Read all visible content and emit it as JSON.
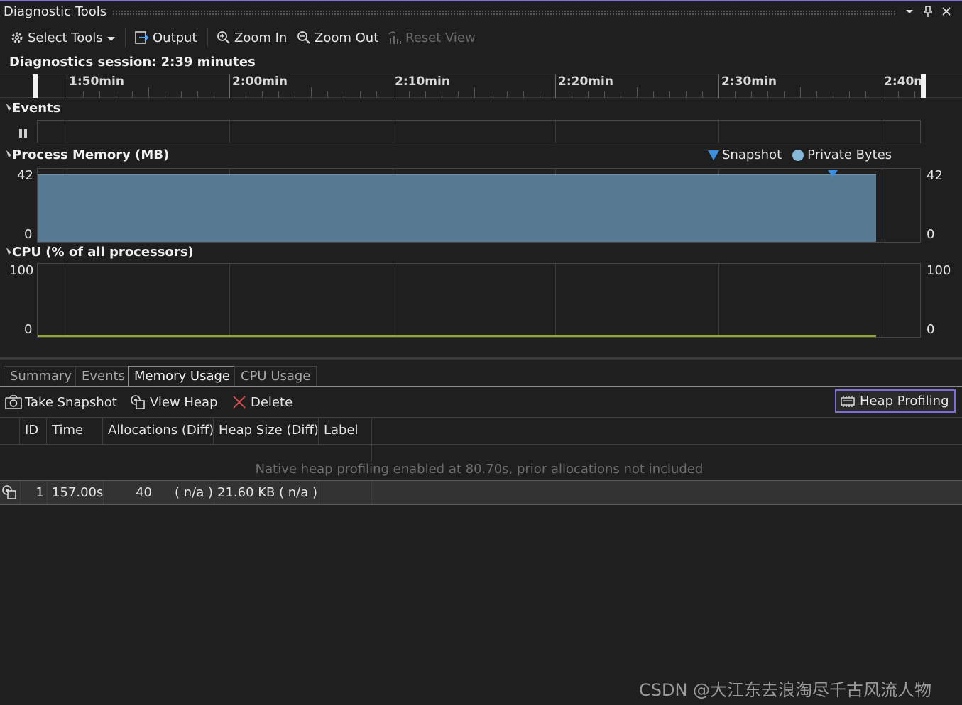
{
  "window": {
    "title": "Diagnostic Tools",
    "title_buttons": [
      "dropdown",
      "pin",
      "close"
    ]
  },
  "toolbar": {
    "select_tools": "Select Tools",
    "output": "Output",
    "zoom_in": "Zoom In",
    "zoom_out": "Zoom Out",
    "reset_view": "Reset View"
  },
  "session": {
    "label": "Diagnostics session: 2:39 minutes"
  },
  "ruler": {
    "labels": [
      "1:50min",
      "2:00min",
      "2:10min",
      "2:20min",
      "2:30min",
      "2:40m"
    ]
  },
  "events": {
    "title": "Events"
  },
  "memory": {
    "title": "Process Memory (MB)",
    "legend_snapshot": "Snapshot",
    "legend_private": "Private Bytes",
    "y_max": "42",
    "y_min": "0",
    "y_max_right": "42",
    "y_min_right": "0",
    "fill_color": "#567a91",
    "snapshot_color": "#3b8fe0",
    "private_color": "#86b8d8"
  },
  "cpu": {
    "title": "CPU (% of all processors)",
    "y_max": "100",
    "y_min": "0",
    "y_max_right": "100",
    "y_min_right": "0",
    "line_color": "#8fa832"
  },
  "tabs": [
    "Summary",
    "Events",
    "Memory Usage",
    "CPU Usage"
  ],
  "actions": {
    "take_snapshot": "Take Snapshot",
    "view_heap": "View Heap",
    "delete": "Delete",
    "heap_profiling": "Heap Profiling"
  },
  "table": {
    "headers": [
      "ID",
      "Time",
      "Allocations (Diff)",
      "Heap Size (Diff)",
      "Label"
    ],
    "notice": "Native heap profiling enabled at 80.70s, prior allocations not included",
    "rows": [
      {
        "id": "1",
        "time": "157.00s",
        "allocations": "40",
        "alloc_diff": "( n/a )",
        "heap_size": "21.60 KB",
        "heap_diff": "( n/a )",
        "label": ""
      }
    ]
  },
  "watermark": "CSDN @大江东去浪淘尽千古风流人物"
}
